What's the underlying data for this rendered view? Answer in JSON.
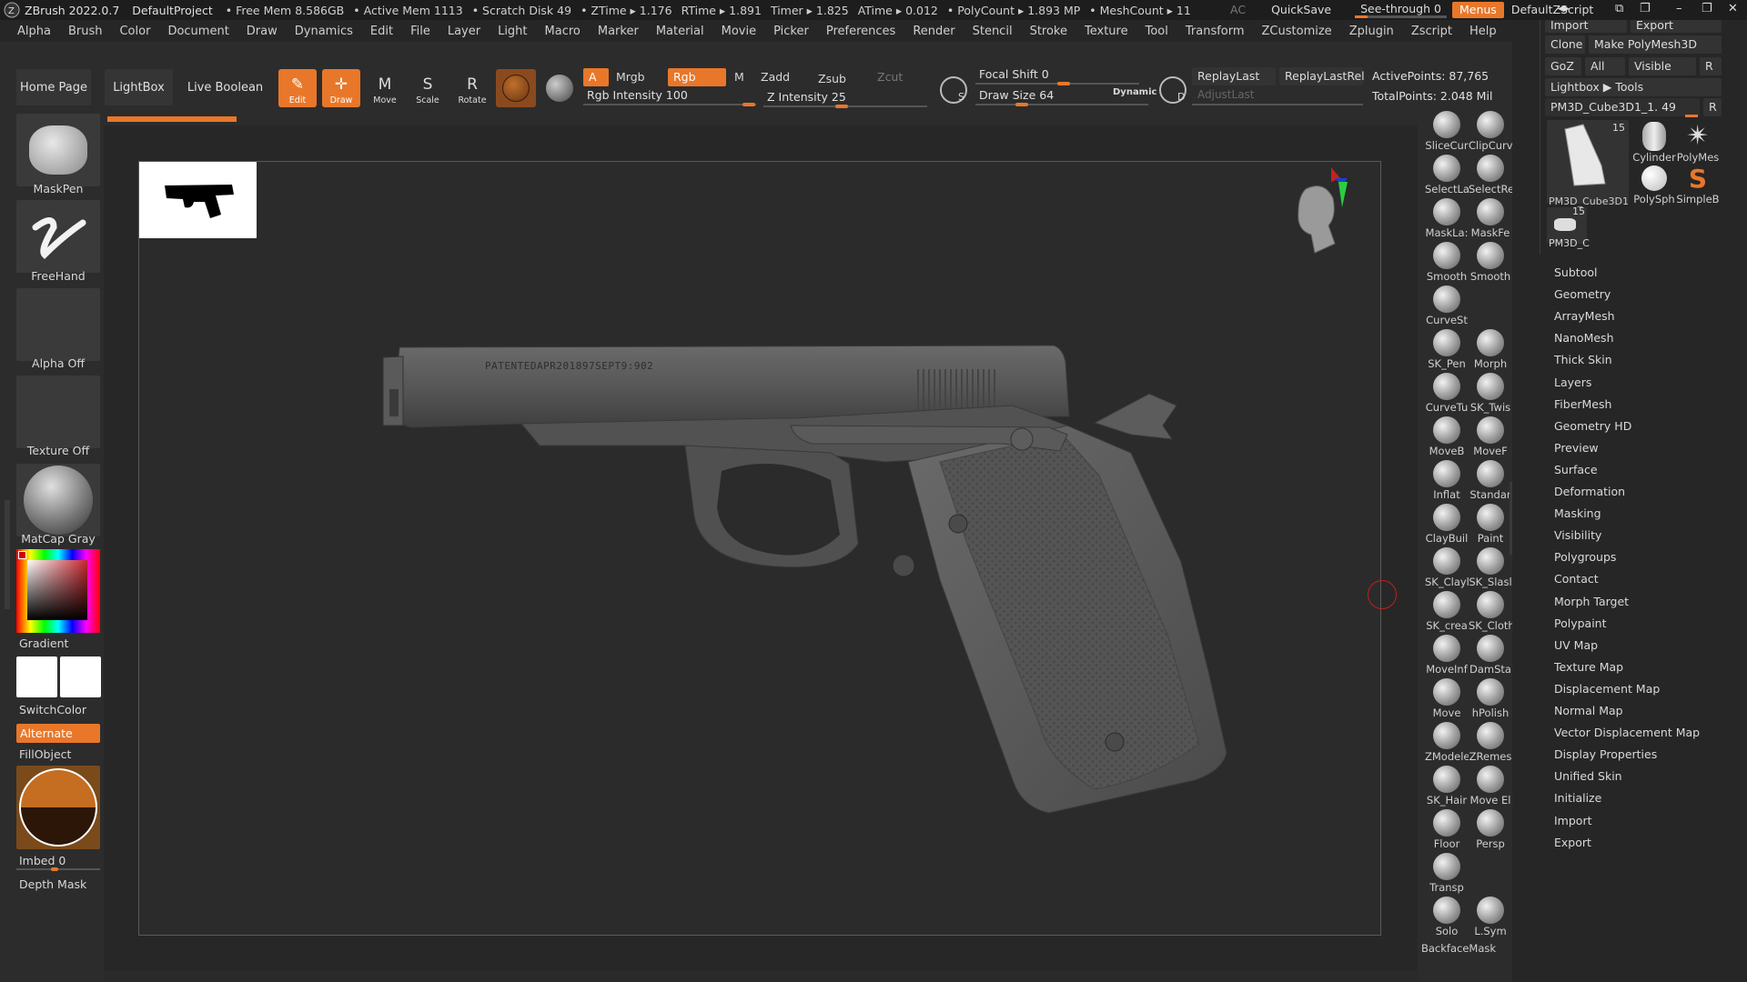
{
  "titlebar": {
    "app": "ZBrush 2022.0.7",
    "project": "DefaultProject",
    "stats": [
      "• Free Mem 8.586GB",
      "• Active Mem 1113",
      "• Scratch Disk 49",
      "• ZTime ▸ 1.176",
      "RTime ▸ 1.891",
      "Timer ▸ 1.825",
      "ATime ▸ 0.012",
      "• PolyCount ▸ 1.893 MP",
      "• MeshCount ▸ 11"
    ],
    "ac": "AC",
    "quicksave": "QuickSave",
    "seethrough": "See-through  0",
    "menus": "Menus",
    "script": "DefaultZScript"
  },
  "menubar": [
    "Alpha",
    "Brush",
    "Color",
    "Document",
    "Draw",
    "Dynamics",
    "Edit",
    "File",
    "Layer",
    "Light",
    "Macro",
    "Marker",
    "Material",
    "Movie",
    "Picker",
    "Preferences",
    "Render",
    "Stencil",
    "Stroke",
    "Texture",
    "Tool",
    "Transform",
    "ZCustomize",
    "Zplugin",
    "Zscript",
    "Help"
  ],
  "shelf": {
    "home": "Home Page",
    "lightbox": "LightBox",
    "liveboolean": "Live Boolean",
    "tools": [
      {
        "label": "Edit",
        "glyph": "✎",
        "active": true
      },
      {
        "label": "Draw",
        "glyph": "✛",
        "active": true
      },
      {
        "label": "Move",
        "glyph": "M",
        "active": false
      },
      {
        "label": "Scale",
        "glyph": "S",
        "active": false
      },
      {
        "label": "Rotate",
        "glyph": "R",
        "active": false
      }
    ],
    "a": "A",
    "mrgb": "Mrgb",
    "rgb": "Rgb",
    "m": "M",
    "zadd": "Zadd",
    "zsub": "Zsub",
    "zcut": "Zcut",
    "rgb_intensity": "Rgb Intensity 100",
    "z_intensity": "Z Intensity 25",
    "focal_shift": "Focal Shift 0",
    "draw_size": "Draw Size 64",
    "dynamic": "Dynamic",
    "replay_last": "ReplayLast",
    "replay_last_rel": "ReplayLastRel",
    "adjust_last": "AdjustLast",
    "active_points": "ActivePoints: 87,765",
    "total_points": "TotalPoints: 2.048 Mil",
    "s": "S",
    "d": "D"
  },
  "left": {
    "maskpen": "MaskPen",
    "freehand": "FreeHand",
    "alpha_off": "Alpha Off",
    "texture_off": "Texture Off",
    "matcap": "MatCap Gray",
    "gradient": "Gradient",
    "switchcolor": "SwitchColor",
    "alternate": "Alternate",
    "fillobject": "FillObject",
    "imbed": "Imbed 0",
    "depthmask": "Depth Mask"
  },
  "model": {
    "engraving": "PATENTEDAPR201897SEPT9:902"
  },
  "brushes": [
    [
      "SliceCur",
      "ClipCurv"
    ],
    [
      "SelectLa",
      "SelectRe"
    ],
    [
      "MaskLa:",
      "MaskFe"
    ],
    [
      "Smooth",
      "Smooth"
    ],
    [
      "CurveSt",
      ""
    ],
    [
      "SK_Pen",
      "Morph"
    ],
    [
      "CurveTu",
      "SK_Twis"
    ],
    [
      "MoveB",
      "MoveF"
    ],
    [
      "Inflat",
      "Standar"
    ],
    [
      "ClayBuil",
      "Paint"
    ],
    [
      "SK_Clayl",
      "SK_Slasl"
    ],
    [
      "SK_crea",
      "SK_Cloth"
    ],
    [
      "MoveInf",
      "DamSta"
    ],
    [
      "Move",
      "hPolish"
    ],
    [
      "ZModele",
      "ZRemes"
    ],
    [
      "SK_Hair",
      "Move El"
    ],
    [
      "Floor",
      "Persp"
    ],
    [
      "Transp",
      ""
    ],
    [
      "Solo",
      "L.Sym"
    ]
  ],
  "backfacemask": "BackfaceMask",
  "right": {
    "import_top": "Import",
    "export_top": "Export",
    "clone": "Clone",
    "make_polymesh": "Make PolyMesh3D",
    "goz": "GoZ",
    "all": "All",
    "visible": "Visible",
    "r": "R",
    "lightbox_tools": "Lightbox ▶ Tools",
    "current_tool": "PM3D_Cube3D1_1. 49",
    "current_r": "R",
    "thumb_count": "15",
    "thumb_name": "PM3D_Cube3D1",
    "cylinder": "Cylinder",
    "polymesh": "PolyMes",
    "polysphere": "PolySph",
    "simpleb": "SimpleB",
    "thumb2_count": "15",
    "thumb2_name": "PM3D_C",
    "menu": [
      "Subtool",
      "Geometry",
      "ArrayMesh",
      "NanoMesh",
      "Thick Skin",
      "Layers",
      "FiberMesh",
      "Geometry HD",
      "Preview",
      "Surface",
      "Deformation",
      "Masking",
      "Visibility",
      "Polygroups",
      "Contact",
      "Morph Target",
      "Polypaint",
      "UV Map",
      "Texture Map",
      "Displacement Map",
      "Normal Map",
      "Vector Displacement Map",
      "Display Properties",
      "Unified Skin",
      "Initialize",
      "Import",
      "Export"
    ]
  },
  "colors": {
    "accent": "#e8772a",
    "background": "#2a2a2a"
  }
}
